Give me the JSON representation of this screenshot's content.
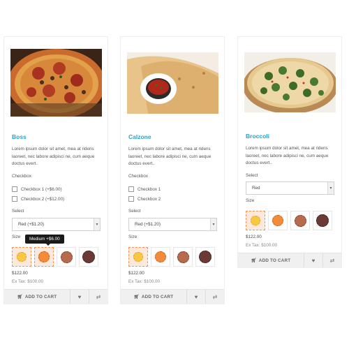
{
  "products": [
    {
      "name": "Boss",
      "description": "Lorem ipsum dolor sit amet, mea at ridens laoreet, nec labore adipisci ne, cum aeque doctus evert..",
      "checkbox_label": "Checkbox",
      "checkboxes": [
        "Checkbox 1 (+$6.00)",
        "Checkbox 2 (+$12.00)"
      ],
      "select_label": "Select",
      "select_value": "Red (+$1.20)",
      "size_label": "Size",
      "tooltip": "Medium +$6.00",
      "price": "$122.00",
      "ex_tax": "Ex Tax: $100.00",
      "add_to_cart": "ADD TO CART"
    },
    {
      "name": "Calzone",
      "description": "Lorem ipsum dolor sit amet, mea at ridens laoreet, nec labore adipisci ne, cum aeque doctus evert..",
      "checkbox_label": "Checkbox",
      "checkboxes": [
        "Checkbox 1",
        "Checkbox 2"
      ],
      "select_label": "Select",
      "select_value": "Red (+$1.20)",
      "size_label": "Size",
      "price": "$122.00",
      "ex_tax": "Ex Tax: $100.00",
      "add_to_cart": "ADD TO CART"
    },
    {
      "name": "Broccoli",
      "description": "Lorem ipsum dolor sit amet, mea at ridens laoreet, nec labore adipisci ne, cum aeque doctus evert..",
      "select_label": "Select",
      "select_value": "Red",
      "size_label": "Size",
      "price": "$122.00",
      "ex_tax": "Ex Tax: $100.00",
      "add_to_cart": "ADD TO CART"
    }
  ],
  "icons": {
    "cart": "shopping-cart-icon",
    "wishlist": "heart-icon",
    "compare": "compare-arrows-icon",
    "dropdown": "chevron-down-icon"
  },
  "colors": {
    "product_name": "#2aa3c3",
    "active_swatch_border": "#f5935c",
    "tooltip_bg": "#1a1a1a",
    "action_bar_bg": "#f0f0f0"
  }
}
